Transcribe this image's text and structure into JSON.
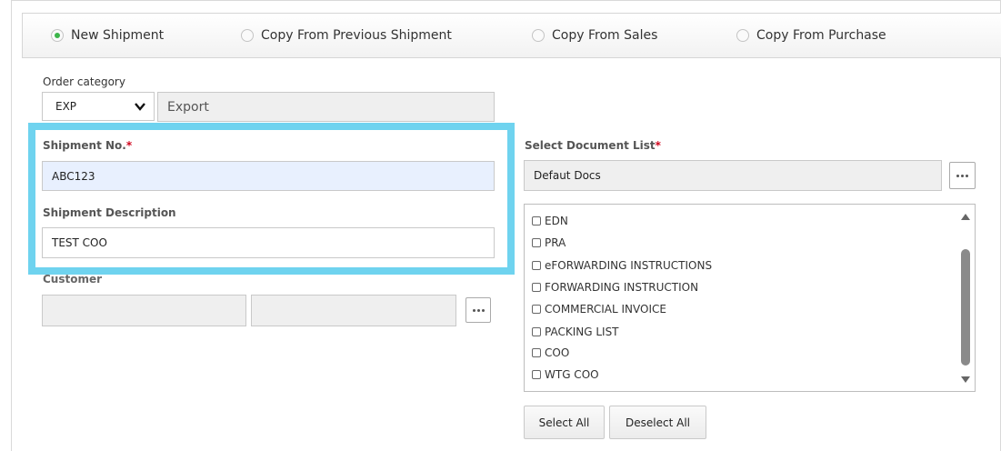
{
  "tabs": [
    {
      "label": "New Shipment",
      "selected": true
    },
    {
      "label": "Copy From Previous Shipment",
      "selected": false
    },
    {
      "label": "Copy From Sales",
      "selected": false
    },
    {
      "label": "Copy From Purchase",
      "selected": false
    }
  ],
  "order_category": {
    "label": "Order category",
    "code": "EXP",
    "description": "Export"
  },
  "shipment_no": {
    "label": "Shipment No.",
    "required": "*",
    "value": "ABC123"
  },
  "shipment_description": {
    "label": "Shipment Description",
    "value": "TEST COO"
  },
  "customer": {
    "label": "Customer",
    "code": "",
    "name": ""
  },
  "document_list": {
    "label": "Select Document List",
    "required": "*",
    "value": "Defaut Docs",
    "items": [
      "EDN",
      "PRA",
      "eFORWARDING INSTRUCTIONS",
      "FORWARDING INSTRUCTION",
      "COMMERCIAL INVOICE",
      "PACKING LIST",
      "COO",
      "WTG COO"
    ]
  },
  "buttons": {
    "select_all": "Select All",
    "deselect_all": "Deselect All"
  },
  "colors": {
    "highlight": "#6fd3ef",
    "radio_selected": "#3cb54a",
    "required": "#d0021b",
    "input_blue": "#e8f0fe"
  }
}
